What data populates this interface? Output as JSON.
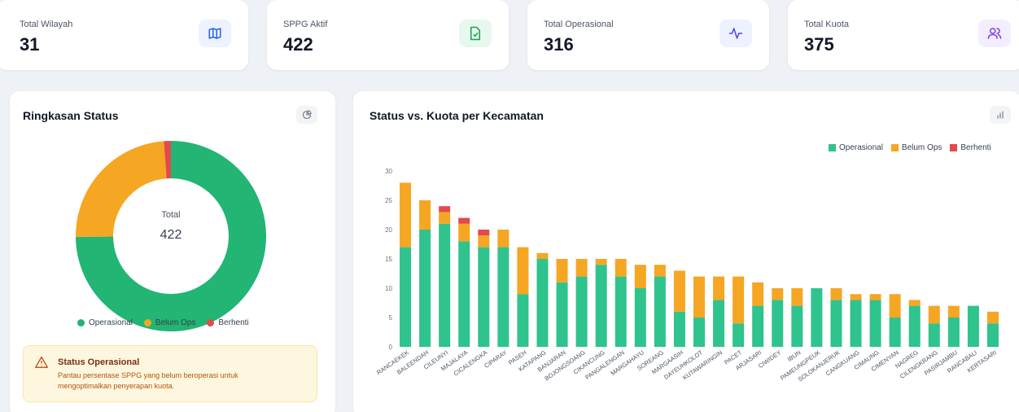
{
  "stats": [
    {
      "label": "Total Wilayah",
      "value": "31",
      "icon": "map-icon",
      "icon_bg": "#eef2ff",
      "icon_color": "#2563eb"
    },
    {
      "label": "SPPG Aktif",
      "value": "422",
      "icon": "check-document-icon",
      "icon_bg": "#e7f8ef",
      "icon_color": "#16a34a"
    },
    {
      "label": "Total Operasional",
      "value": "316",
      "icon": "activity-icon",
      "icon_bg": "#eef2ff",
      "icon_color": "#4f46e5"
    },
    {
      "label": "Total Kuota",
      "value": "375",
      "icon": "users-icon",
      "icon_bg": "#f3eefe",
      "icon_color": "#7c3aed"
    }
  ],
  "summary": {
    "title": "Ringkasan Status",
    "tool_icon": "pie-chart-icon",
    "center_label": "Total",
    "center_value": "422",
    "legend": [
      {
        "name": "Operasional",
        "color": "#22b573"
      },
      {
        "name": "Belum Ops",
        "color": "#f5a623"
      },
      {
        "name": "Berhenti",
        "color": "#e5484d"
      }
    ],
    "alert": {
      "icon": "warning-icon",
      "title": "Status Operasional",
      "text": "Pantau persentase SPPG yang belum beroperasi untuk mengoptimalkan penyerapan kuota."
    }
  },
  "chart_data": [
    {
      "type": "pie",
      "title": "Ringkasan Status",
      "labels": [
        "Operasional",
        "Belum Ops",
        "Berhenti"
      ],
      "values": [
        316,
        101,
        5
      ],
      "colors": [
        "#22b573",
        "#f5a623",
        "#e5484d"
      ]
    },
    {
      "type": "bar",
      "stacked": true,
      "title": "Status vs. Kuota per Kecamatan",
      "categories": [
        "RANCAEKEK",
        "BALEENDAH",
        "CILEUNYI",
        "MAJALAYA",
        "CICALENGKA",
        "CIPARAY",
        "PASEH",
        "KATAPANG",
        "BANJARAN",
        "BOJONGSOANG",
        "CIKANCUNG",
        "PANGALENGAN",
        "MARGAHAYU",
        "SOREANG",
        "MARGAASIH",
        "DAYEUHKOLOT",
        "KUTAWARINGIN",
        "PACET",
        "ARJASARI",
        "CIWIDEY",
        "IBUN",
        "PAMEUNGPEUK",
        "SOLOKANJERUK",
        "CANGKUANG",
        "CIMAUNG",
        "CIMENYAN",
        "NAGREG",
        "CILENGKRANG",
        "PASIRJAMBU",
        "RANCABALI",
        "KERTASARI"
      ],
      "series": [
        {
          "name": "Operasional",
          "color": "#2fc38d",
          "values": [
            17,
            20,
            21,
            18,
            17,
            17,
            9,
            15,
            11,
            12,
            14,
            12,
            10,
            12,
            6,
            5,
            8,
            4,
            7,
            8,
            7,
            10,
            8,
            8,
            8,
            5,
            7,
            4,
            5,
            7,
            4
          ]
        },
        {
          "name": "Belum Ops",
          "color": "#f5a623",
          "values": [
            11,
            5,
            2,
            3,
            2,
            3,
            8,
            1,
            4,
            3,
            1,
            3,
            4,
            2,
            7,
            7,
            4,
            8,
            4,
            2,
            3,
            0,
            2,
            1,
            1,
            4,
            1,
            3,
            2,
            0,
            2
          ]
        },
        {
          "name": "Berhenti",
          "color": "#e5484d",
          "values": [
            0,
            0,
            1,
            1,
            1,
            0,
            0,
            0,
            0,
            0,
            0,
            0,
            0,
            0,
            0,
            0,
            0,
            0,
            0,
            0,
            0,
            0,
            0,
            0,
            0,
            0,
            0,
            0,
            0,
            0,
            0
          ]
        }
      ],
      "ylim": [
        0,
        30
      ],
      "yticks": [
        0,
        5,
        10,
        15,
        20,
        25,
        30
      ],
      "grid": false,
      "legend_position": "top-right",
      "tool_icon": "bar-chart-icon"
    }
  ]
}
